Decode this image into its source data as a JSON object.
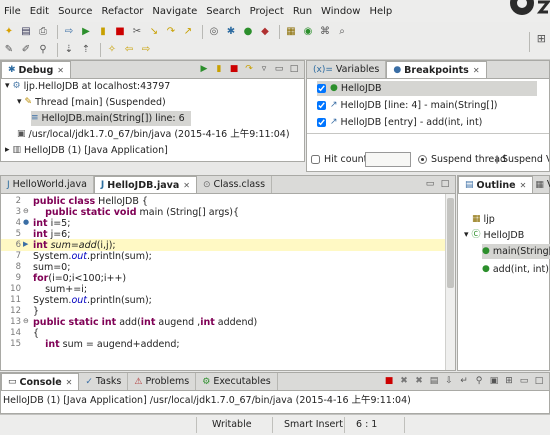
{
  "menu": [
    "File",
    "Edit",
    "Source",
    "Refactor",
    "Navigate",
    "Search",
    "Project",
    "Run",
    "Window",
    "Help"
  ],
  "debug": {
    "tab_label": "Debug",
    "items": [
      "ljp.HelloJDB at localhost:43797",
      "Thread [main] (Suspended)",
      "HelloJDB.main(String[]) line: 6",
      "/usr/local/jdk1.7.0_67/bin/java (2015-4-16 上午9:11:04)",
      "HelloJDB (1) [Java Application]"
    ]
  },
  "breakpoints": {
    "tab_variables": "Variables",
    "tab_breakpoints": "Breakpoints",
    "items": [
      "HelloJDB",
      "HelloJDB [line: 4] - main(String[])",
      "HelloJDB [entry] - add(int, int)"
    ],
    "hit_count_label": "Hit count:",
    "hit_count_value": "",
    "suspend_thread": "Suspend thread",
    "suspend_vm": "Suspend VM"
  },
  "editor": {
    "tabs": [
      "HelloWorld.java",
      "HelloJDB.java",
      "Class.class"
    ],
    "line_numbers": [
      "2",
      "3",
      "4",
      "5",
      "6",
      "7",
      "8",
      "9",
      "10",
      "11",
      "12",
      "13",
      "14",
      "15"
    ]
  },
  "outline": {
    "tab_outline": "Outline",
    "tab_more": "Vi",
    "items": [
      "ljp",
      "HelloJDB",
      "main(String[])",
      "add(int, int) : "
    ]
  },
  "console": {
    "tabs": [
      "Console",
      "Tasks",
      "Problems",
      "Executables"
    ],
    "line": "HelloJDB (1) [Java Application] /usr/local/jdk1.7.0_67/bin/java (2015-4-16 上午9:11:04)"
  },
  "status": {
    "writable": "Writable",
    "insert_mode": "Smart Insert",
    "position": "6 : 1"
  }
}
